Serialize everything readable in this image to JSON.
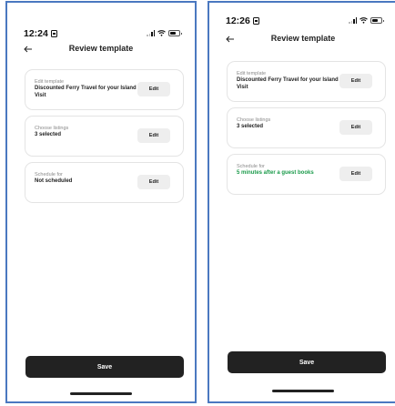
{
  "screens": [
    {
      "status": {
        "time": "12:24"
      },
      "header": {
        "title": "Review template"
      },
      "cards": [
        {
          "label": "Edit template",
          "value": "Discounted Ferry Travel for your Island Visit",
          "edit_label": "Edit"
        },
        {
          "label": "Choose listings",
          "value": "3 selected",
          "edit_label": "Edit"
        },
        {
          "label": "Schedule for",
          "value": "Not scheduled",
          "edit_label": "Edit"
        }
      ],
      "save_label": "Save"
    },
    {
      "status": {
        "time": "12:26"
      },
      "header": {
        "title": "Review template"
      },
      "cards": [
        {
          "label": "Edit template",
          "value": "Discounted Ferry Travel for your Island Visit",
          "edit_label": "Edit"
        },
        {
          "label": "Choose listings",
          "value": "3 selected",
          "edit_label": "Edit"
        },
        {
          "label": "Schedule for",
          "value": "5 minutes after a guest books",
          "edit_label": "Edit"
        }
      ],
      "save_label": "Save"
    }
  ],
  "colors": {
    "frame_border": "#4a78c0",
    "scheduled_value": "#1a9a4a",
    "save_button": "#222222",
    "edit_button": "#eeeeee"
  },
  "icons": {
    "back": "arrow-left-icon",
    "signal": "signal-icon",
    "wifi": "wifi-icon",
    "battery": "battery-icon"
  }
}
